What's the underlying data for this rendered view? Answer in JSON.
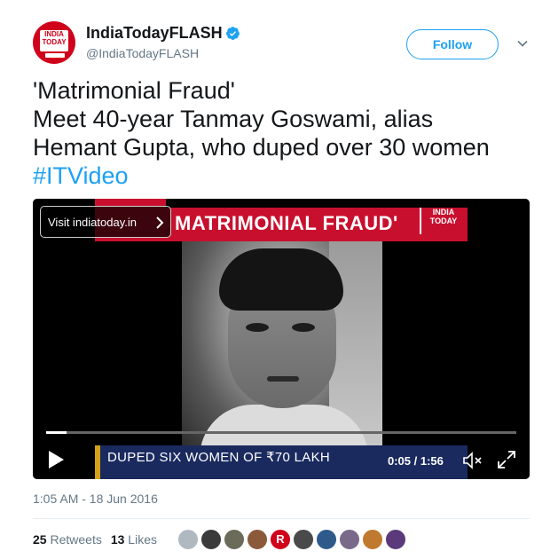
{
  "account": {
    "display_name": "IndiaTodayFLASH",
    "handle": "@IndiaTodayFLASH",
    "avatar_logo_line1": "INDIA",
    "avatar_logo_line2": "TODAY",
    "verified": true
  },
  "actions": {
    "follow_label": "Follow",
    "more_icon": "chevron-down-icon"
  },
  "tweet": {
    "line1": "'Matrimonial Fraud'",
    "line2": "Meet 40-year Tanmay Goswami, alias",
    "line3": "Hemant Gupta, who duped over 30 women",
    "hashtag": "#ITVideo"
  },
  "video": {
    "visit_label": "Visit indiatoday.in",
    "banner_title": "MATRIMONIAL FRAUD'",
    "channel_logo_line1": "INDIA",
    "channel_logo_line2": "TODAY",
    "lower_third": "DUPED SIX WOMEN OF ₹70 LAKH",
    "time": "0:05 / 1:56",
    "progress": 0.044,
    "colors": {
      "banner_red": "#c8102e",
      "lower_third_blue": "#1a2a5e",
      "lower_third_accent": "#d4a017"
    }
  },
  "meta": {
    "timestamp": "1:05 AM - 18 Jun 2016",
    "retweets_count": "25",
    "retweets_label": "Retweets",
    "likes_count": "13",
    "likes_label": "Likes"
  },
  "likers": [
    {
      "color": "#b0b8c0"
    },
    {
      "color": "#3a3a3a"
    },
    {
      "color": "#6b6b5a"
    },
    {
      "color": "#8a5a3a"
    },
    {
      "color": "#d0021b",
      "letter": "R"
    },
    {
      "color": "#4a4a4a"
    },
    {
      "color": "#2d5a8a"
    },
    {
      "color": "#7a6a8a"
    },
    {
      "color": "#c07a30"
    },
    {
      "color": "#5a3a7a"
    }
  ],
  "theme": {
    "twitter_blue": "#1da1f2",
    "text_primary": "#14171a",
    "text_secondary": "#657786"
  }
}
